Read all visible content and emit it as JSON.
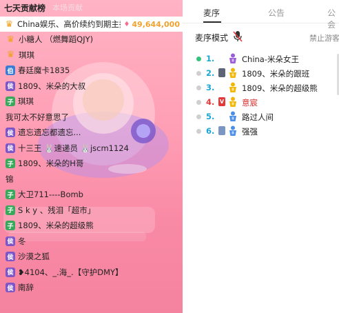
{
  "left_panel": {
    "title": "七天贡献榜",
    "subtitle": "本场贡献",
    "rows": [
      {
        "badge": "♛",
        "badge_style": "crown",
        "name": "China娱乐、高价续约到期主播",
        "score": "49,644,000"
      },
      {
        "badge": "♛",
        "badge_style": "crown",
        "name": "小糖人 （燃舞蹈QJY)",
        "score": ""
      },
      {
        "badge": "♛",
        "badge_style": "crown",
        "name": "琪琪",
        "score": ""
      },
      {
        "badge": "伯",
        "badge_style": "blue",
        "name": "春廷魔卡1835",
        "score": ""
      },
      {
        "badge": "侯",
        "badge_style": "purple",
        "name": "1809、米朵的大叔",
        "score": ""
      },
      {
        "badge": "子",
        "badge_style": "green",
        "name": "琪琪",
        "score": ""
      },
      {
        "badge": "",
        "badge_style": "none",
        "name": "我可太不好意思了",
        "score": ""
      },
      {
        "badge": "侯",
        "badge_style": "purple",
        "name": "遗忘遗忘都遗忘...",
        "score": ""
      },
      {
        "badge": "侯",
        "badge_style": "purple",
        "name": "十三王 🐰速递员 🐰jscm1124",
        "score": ""
      },
      {
        "badge": "子",
        "badge_style": "green",
        "name": "1809、米朵的H哥",
        "score": ""
      },
      {
        "badge": "",
        "badge_style": "none",
        "name": "锦",
        "score": ""
      },
      {
        "badge": "子",
        "badge_style": "green",
        "name": "大卫711----Bomb",
        "score": ""
      },
      {
        "badge": "子",
        "badge_style": "green",
        "name": "S k y 、残泪「超市」",
        "score": ""
      },
      {
        "badge": "子",
        "badge_style": "green",
        "name": "1809、米朵的超级熊",
        "score": ""
      },
      {
        "badge": "侯",
        "badge_style": "purple",
        "name": "冬",
        "score": ""
      },
      {
        "badge": "侯",
        "badge_style": "purple",
        "name": "沙漠之狐",
        "score": ""
      },
      {
        "badge": "侯",
        "badge_style": "purple",
        "name": "❥4104、_.海_.【守护DMY】",
        "score": ""
      },
      {
        "badge": "侯",
        "badge_style": "purple",
        "name": "南辞",
        "score": ""
      }
    ]
  },
  "right_panel": {
    "tabs": [
      "麦序",
      "公告",
      "公会"
    ],
    "active_tab": 0,
    "mode_label": "麦序模式",
    "ban_visitor_label": "禁止游客",
    "queue": [
      {
        "num": "1.",
        "name": "China-米朵女王",
        "online": true,
        "tags": [],
        "red": false
      },
      {
        "num": "2.",
        "name": "1809、米朵的跟班",
        "online": false,
        "tags": [
          "phone"
        ],
        "red": false
      },
      {
        "num": "3.",
        "name": "1809、米朵的超级熊",
        "online": false,
        "tags": [],
        "red": false
      },
      {
        "num": "4.",
        "name": "意宸",
        "online": false,
        "tags": [
          "v"
        ],
        "red": true
      },
      {
        "num": "5.",
        "name": "路过人间",
        "online": false,
        "tags": [],
        "red": false
      },
      {
        "num": "6.",
        "name": "强强",
        "online": false,
        "tags": [
          "note"
        ],
        "red": false
      }
    ]
  },
  "colors": {
    "gold": "#f0a22e",
    "online": "#34c37b",
    "rank_num": "#19a6d6",
    "red": "#e53838"
  }
}
